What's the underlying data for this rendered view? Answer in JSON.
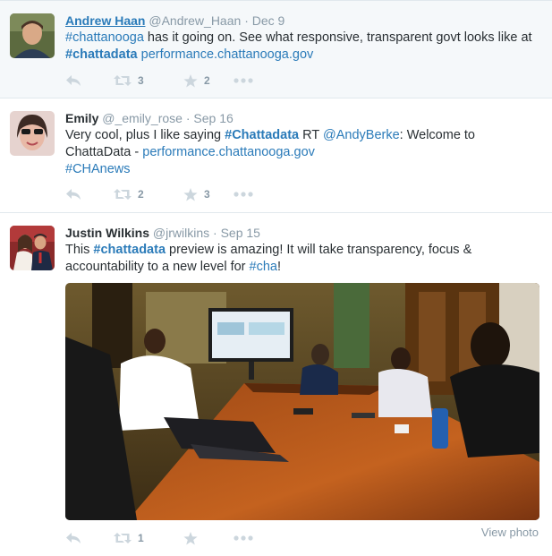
{
  "tweets": [
    {
      "fullname": "Andrew Haan",
      "username": "@Andrew_Haan",
      "separator": "·",
      "time": "Dec 9",
      "text": {
        "hashtag1": "#chattanooga",
        "p1": " has it going on. See what responsive, transparent govt looks like at ",
        "hashtag2": "#chattadata",
        "p2": " ",
        "link": "performance.chattanooga.gov"
      },
      "retweets": "3",
      "favorites": "2"
    },
    {
      "fullname": "Emily",
      "username": "@_emily_rose",
      "separator": "·",
      "time": "Sep 16",
      "text": {
        "p1": "Very cool, plus I like saying ",
        "hashtag1": "#Chattadata",
        "p2": " RT ",
        "mention": "@AndyBerke",
        "p3": ": Welcome to ChattaData - ",
        "link": "performance.chattanooga.gov",
        "hashtag2": "#CHAnews"
      },
      "retweets": "2",
      "favorites": "3"
    },
    {
      "fullname": "Justin Wilkins",
      "username": "@jrwilkins",
      "separator": "·",
      "time": "Sep 15",
      "text": {
        "p1": "This ",
        "hashtag1": "#chattadata",
        "p2": " preview is amazing! It will take transparency, focus & accountability to a new level for ",
        "hashtag2": "#cha",
        "p3": "!"
      },
      "retweets": "1",
      "view_photo": "View photo"
    }
  ],
  "icons": {
    "reply": "reply-icon",
    "retweet": "retweet-icon",
    "favorite": "star-icon",
    "more": "more-icon"
  },
  "colors": {
    "link": "#2b7bb9",
    "muted": "#8899a6",
    "action": "#ccd6dd",
    "highlight_bg": "#f5f8fa"
  }
}
